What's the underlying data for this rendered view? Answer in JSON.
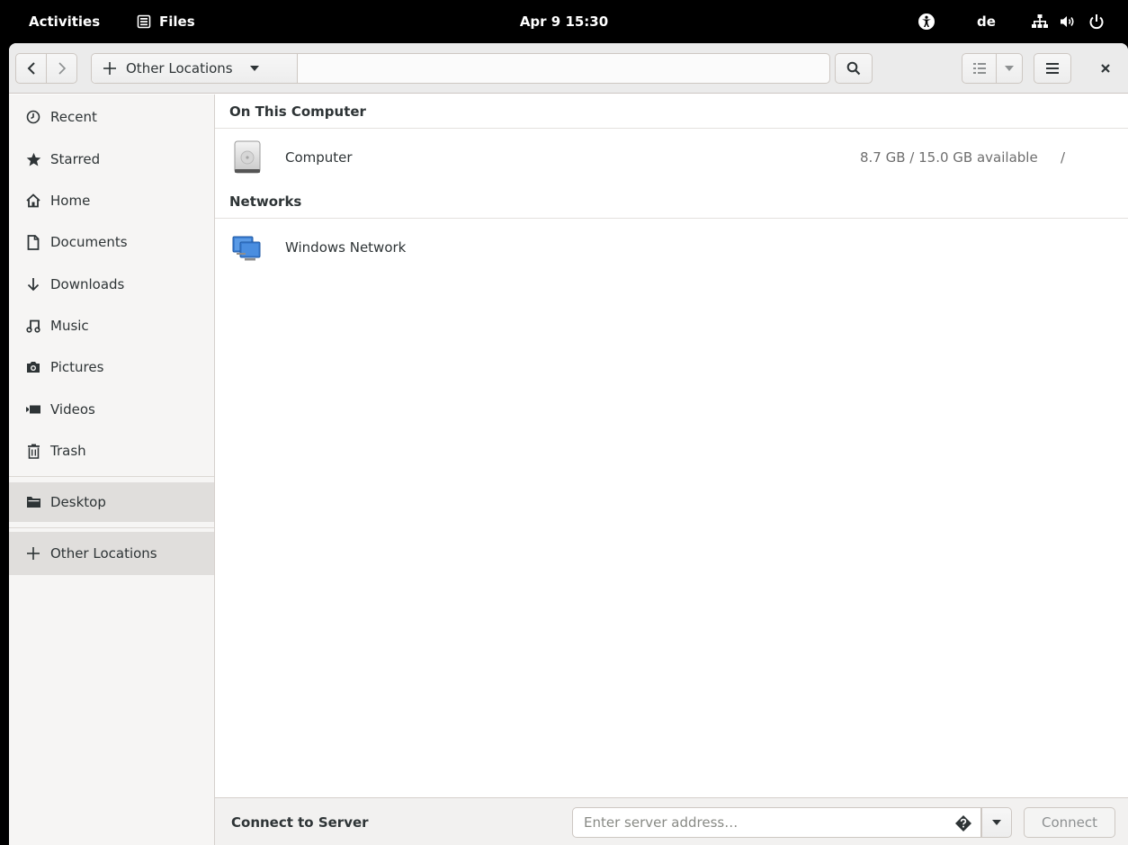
{
  "topbar": {
    "activities": "Activities",
    "app_name": "Files",
    "clock": "Apr 9  15:30",
    "language": "de"
  },
  "header": {
    "path_label": "Other Locations"
  },
  "sidebar": {
    "items": [
      {
        "label": "Recent",
        "icon": "clock-icon"
      },
      {
        "label": "Starred",
        "icon": "star-icon"
      },
      {
        "label": "Home",
        "icon": "home-icon"
      },
      {
        "label": "Documents",
        "icon": "document-icon"
      },
      {
        "label": "Downloads",
        "icon": "download-icon"
      },
      {
        "label": "Music",
        "icon": "music-icon"
      },
      {
        "label": "Pictures",
        "icon": "camera-icon"
      },
      {
        "label": "Videos",
        "icon": "video-icon"
      },
      {
        "label": "Trash",
        "icon": "trash-icon"
      }
    ],
    "bookmarks": [
      {
        "label": "Desktop",
        "icon": "folder-icon"
      }
    ],
    "other_locations": {
      "label": "Other Locations",
      "icon": "plus-icon",
      "active": true
    }
  },
  "content": {
    "sections": [
      {
        "title": "On This Computer",
        "rows": [
          {
            "name": "Computer",
            "info": "8.7 GB / 15.0 GB available",
            "path": "/",
            "icon": "harddisk-icon"
          }
        ]
      },
      {
        "title": "Networks",
        "rows": [
          {
            "name": "Windows Network",
            "info": "",
            "path": "",
            "icon": "network-computers-icon"
          }
        ]
      }
    ]
  },
  "bottombar": {
    "label": "Connect to Server",
    "input_placeholder": "Enter server address…",
    "connect_label": "Connect"
  }
}
